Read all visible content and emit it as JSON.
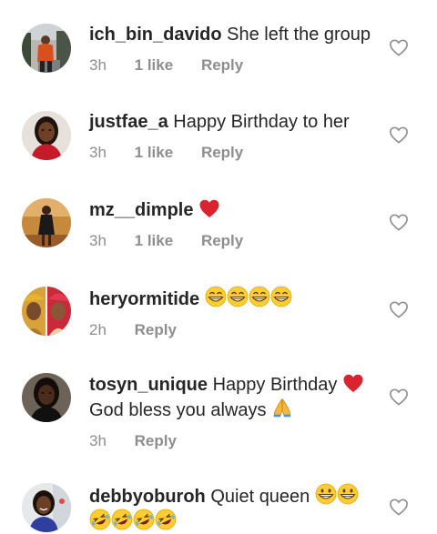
{
  "comments": [
    {
      "username": "ich_bin_davido",
      "text": "She left the group",
      "time": "3h",
      "likes": "1 like",
      "reply": "Reply",
      "avatar": "avatar-photo-man-outdoors"
    },
    {
      "username": "justfae_a",
      "text": "Happy Birthday to her",
      "time": "3h",
      "likes": "1 like",
      "reply": "Reply",
      "avatar": "avatar-photo-woman-red-top"
    },
    {
      "username": "mz__dimple",
      "text": "",
      "time": "3h",
      "likes": "1 like",
      "reply": "Reply",
      "avatar": "avatar-photo-woman-dress"
    },
    {
      "username": "heryormitide",
      "text": "",
      "time": "2h",
      "reply": "Reply",
      "avatar": "avatar-photo-two-women-geles"
    },
    {
      "username": "tosyn_unique",
      "text": "Happy Birthday",
      "text2": "God bless you always",
      "time": "3h",
      "reply": "Reply",
      "avatar": "avatar-photo-woman-dark"
    },
    {
      "username": "debbyoburoh",
      "text": "Quiet queen",
      "avatar": "avatar-photo-woman-smiling"
    }
  ],
  "emojis": [
    "red-heart",
    "grinning-face",
    "folded-hands",
    "rolling-on-floor-laughing"
  ],
  "colors": {
    "text": "#262626",
    "meta": "#8e8e8e",
    "heart": "#d9232e",
    "emoji_yellow": "#ffcc33"
  }
}
